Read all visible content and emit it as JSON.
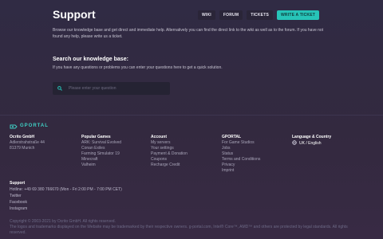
{
  "header": {
    "title": "Support",
    "nav": [
      {
        "label": "WIKI"
      },
      {
        "label": "FORUM"
      },
      {
        "label": "TICKETS"
      },
      {
        "label": "WRITE A TICKET"
      }
    ]
  },
  "intro": {
    "text": "Browse our knowledge base and get direct and immediate help. Alternatively you can find the direct link to the wiki as well as to the forum. If you have not found any help, please write us a ticket."
  },
  "knowledge_base": {
    "title": "Search our knowledge base:",
    "subtitle": "If you have any questions or problems you can enter your questions here to get a quick solution.",
    "search_placeholder": "Please enter your question"
  },
  "footer": {
    "logo_text": "GPORTAL",
    "company": {
      "title": "Ocrito GmbH",
      "lines": [
        "Adlerstrahstraße 44",
        "81379 Munich"
      ]
    },
    "popular_games": {
      "title": "Popular Games",
      "items": [
        "ARK: Survival Evolved",
        "Conan Exiles",
        "Farming Simulator 19",
        "Minecraft",
        "Valheim"
      ]
    },
    "account": {
      "title": "Account",
      "items": [
        "My servers",
        "Your settings",
        "Payment & Donation",
        "Coupons",
        "Recharge Credit"
      ]
    },
    "gportal": {
      "title": "GPORTAL",
      "items": [
        "For Game Studios",
        "Jobs",
        "Status",
        "Terms and Conditions",
        "Privacy",
        "Imprint"
      ]
    },
    "language": {
      "title": "Language & Country",
      "value": "UK / English"
    },
    "support": {
      "title": "Support",
      "items": [
        "Hotline: +49 69 380 766670 (Mon - Fri 2:00 PM - 7:00 PM CET)",
        "Twitter",
        "Facebook",
        "Instagram"
      ]
    },
    "legal": {
      "copyright": "Copyright © 2003-2021 by Ocrito GmbH. All rights reserved.",
      "trademarks": "The logos and trademarks displayed on the Website may be trademarked by their respective owners. g-portal.com, Intel® Core™, AMD™ and others are protected by legal standards. All rights reserved."
    }
  },
  "colors": {
    "accent": "#27c4b8",
    "background": "#302b44"
  }
}
